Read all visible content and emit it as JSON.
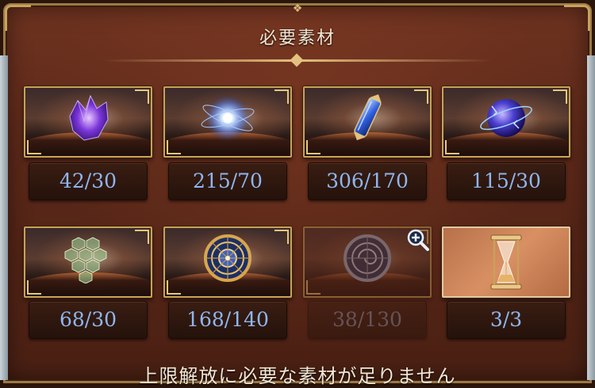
{
  "header": {
    "title": "必要素材"
  },
  "materials": [
    {
      "icon": "purple-crystal-icon",
      "count": "42/30",
      "available": true
    },
    {
      "icon": "light-orb-icon",
      "count": "215/70",
      "available": true
    },
    {
      "icon": "blue-gem-pillar-icon",
      "count": "306/170",
      "available": true
    },
    {
      "icon": "blue-sphere-icon",
      "count": "115/30",
      "available": true
    },
    {
      "icon": "green-hex-scale-icon",
      "count": "68/30",
      "available": true
    },
    {
      "icon": "golden-astrolabe-icon",
      "count": "168/140",
      "available": true
    },
    {
      "icon": "silver-astrolabe-icon",
      "count": "38/130",
      "available": false
    },
    {
      "icon": "hourglass-icon",
      "count": "3/3",
      "available": true
    }
  ],
  "footer": {
    "message": "上限解放に必要な素材が足りません"
  },
  "colors": {
    "count_text": "#8eb6f0",
    "frame_gold": "#c7a357",
    "panel": "#5b2819"
  }
}
